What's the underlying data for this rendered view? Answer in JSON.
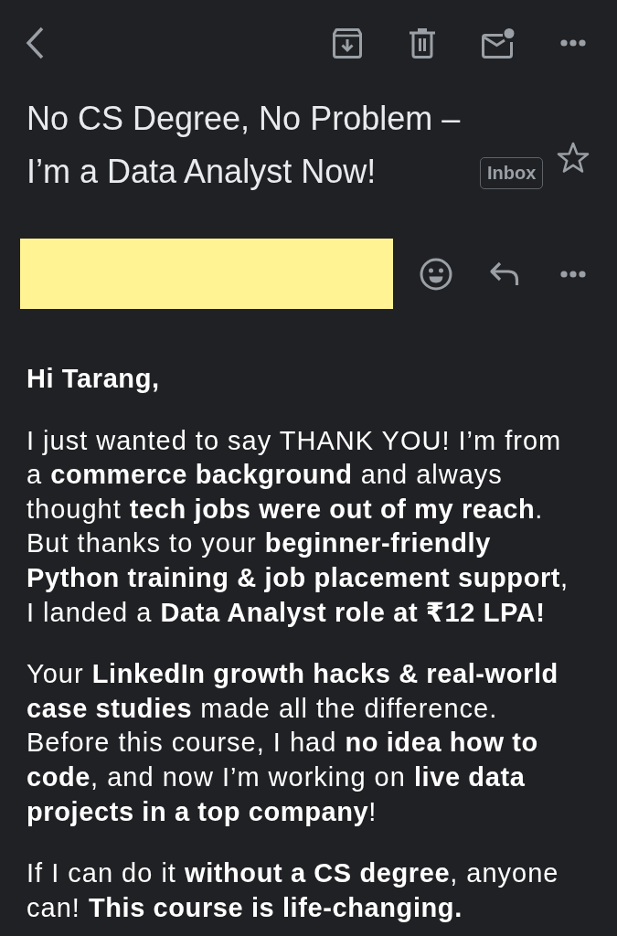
{
  "email": {
    "subject": "No CS Degree, No Problem – I’m a Data Analyst Now!",
    "label": "Inbox",
    "starred": false
  },
  "sender": {
    "redacted": true
  },
  "body": [
    {
      "kind": "greeting",
      "text": "Hi Tarang,"
    },
    {
      "kind": "paragraph",
      "text": "I just wanted to say THANK YOU! I’m from a **commerce background** and always thought **tech jobs were out of my reach**. But thanks to your **beginner-friendly Python training & job placement support**, I landed a **Data Analyst role at ₹12 LPA!**"
    },
    {
      "kind": "paragraph",
      "text": "Your **LinkedIn growth hacks & real-world case studies** made all the difference. Before this course, I had **no idea how to code**, and now I’m working on **live data projects in a top company**!"
    },
    {
      "kind": "paragraph",
      "text": "If I can do it **without a CS degree**, anyone can! **This course is life-changing.**"
    }
  ]
}
